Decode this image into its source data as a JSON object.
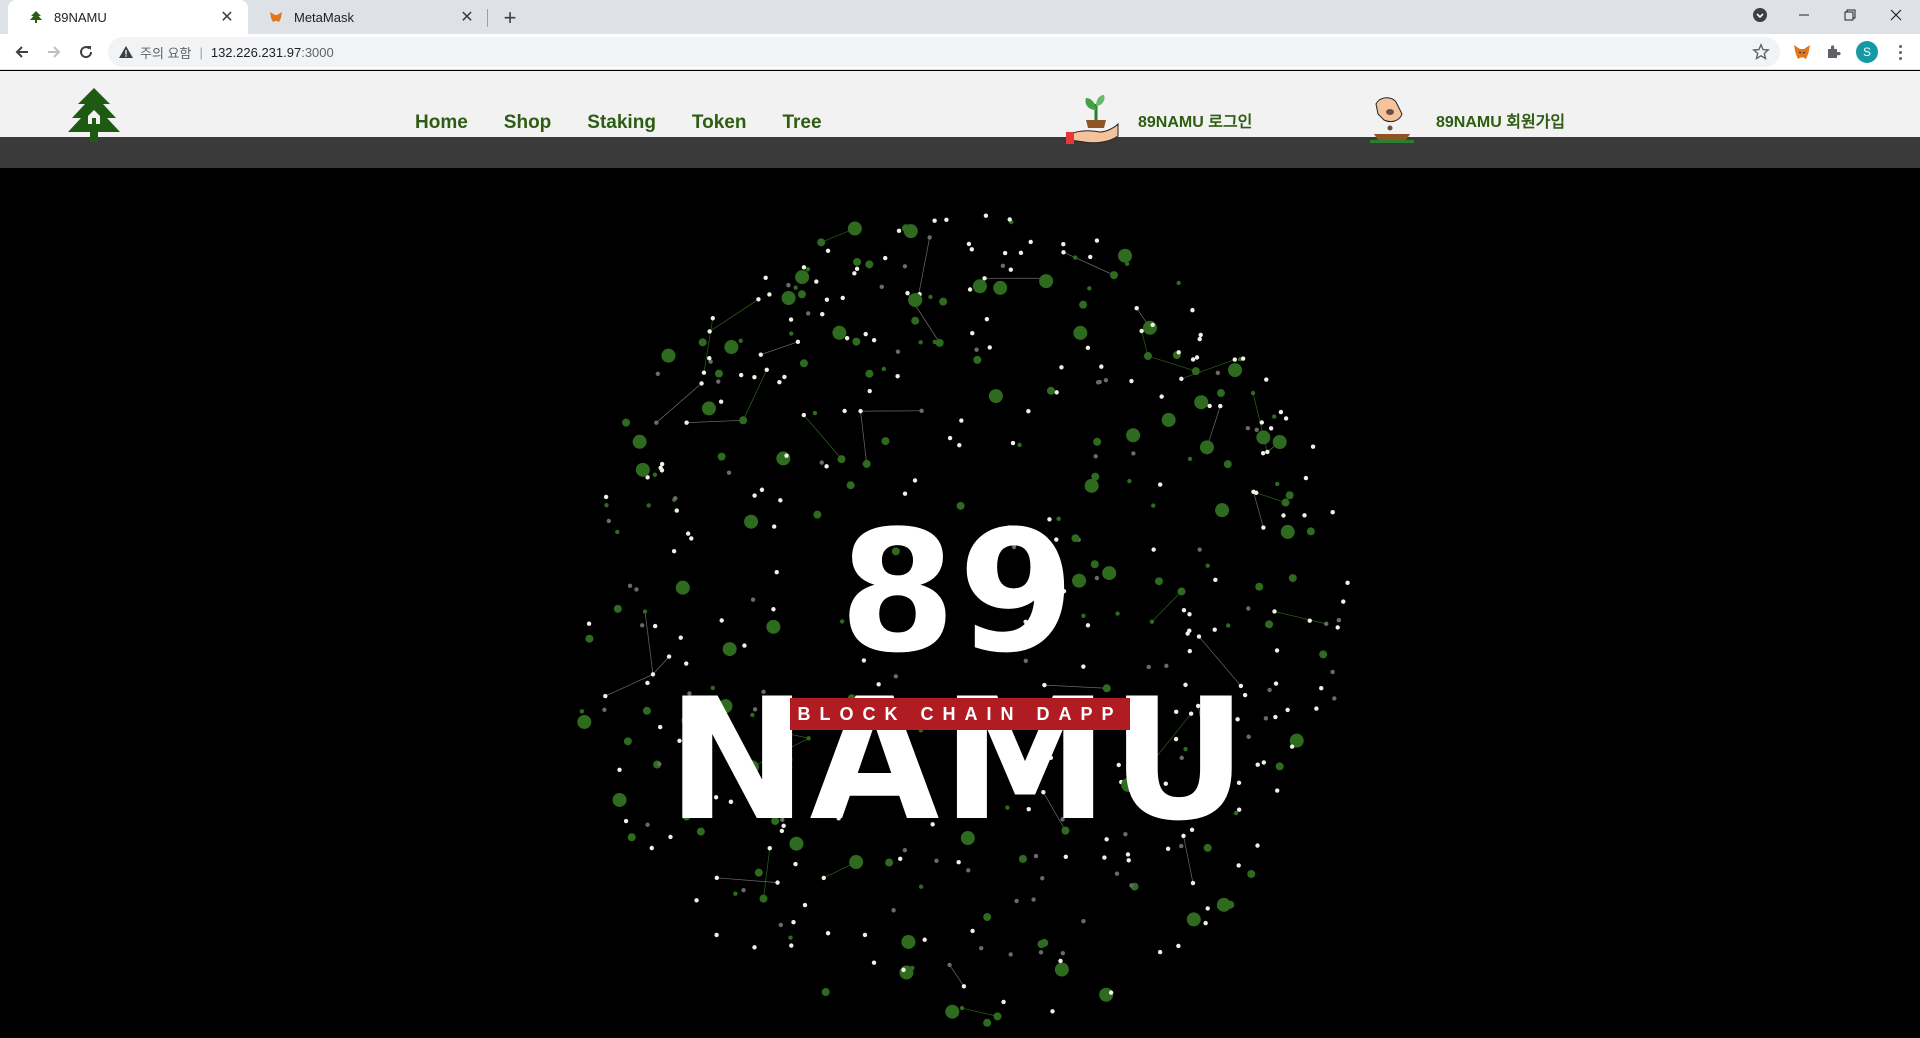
{
  "browser": {
    "tabs": [
      {
        "title": "89NAMU",
        "icon": "tree-favicon-icon",
        "active": true
      },
      {
        "title": "MetaMask",
        "icon": "metamask-fox-icon",
        "active": false
      }
    ],
    "address": {
      "security_label": "주의 요함",
      "divider": "|",
      "host": "132.226.231.97",
      "port": ":3000"
    },
    "profile_initial": "S"
  },
  "site": {
    "nav": [
      {
        "label": "Home"
      },
      {
        "label": "Shop"
      },
      {
        "label": "Staking"
      },
      {
        "label": "Token"
      },
      {
        "label": "Tree"
      }
    ],
    "login_label": "89NAMU 로그인",
    "signup_label": "89NAMU 회원가입",
    "colors": {
      "nav_text": "#2e5c12",
      "header_bg": "#f2f2f2",
      "subbar_bg": "#3a3a3a",
      "badge_bg": "#b01c22"
    }
  },
  "hero": {
    "title": "89 NAMU",
    "badge": "BLOCK CHAIN DAPP"
  }
}
